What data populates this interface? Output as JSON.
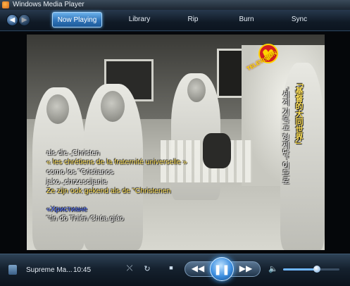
{
  "window": {
    "title": "Windows Media Player"
  },
  "nav": {
    "back_icon": "back-arrow-icon",
    "forward_icon": "forward-arrow-icon",
    "tabs": [
      {
        "label": "Now Playing",
        "active": true
      },
      {
        "label": "Library",
        "active": false
      },
      {
        "label": "Rip",
        "active": false
      },
      {
        "label": "Burn",
        "active": false
      },
      {
        "label": "Sync",
        "active": false
      }
    ]
  },
  "video": {
    "channel_logo_text": "TELEVISION",
    "subtitles": [
      "als die „Christen",
      "« les chrétiens de la fraternité universelle »",
      "como los \"Cristianos",
      "jako „chrzescijanie",
      "Ze zijn ook gekend als de \"Christenen",
      "«Христиане",
      "\"tín đồ Thiên Chúa giáo"
    ],
    "vertical_chinese": "「基督的大同世界」",
    "vertical_korean": "\"세계 기독교 형제단\" 이므로"
  },
  "controls": {
    "current_media": "Supreme Ma...",
    "time": "10:45",
    "volume_level": 0.6,
    "colors": {
      "accent": "#3c8ee0",
      "subtitle_yellow": "#ffe15a",
      "subtitle_blue": "#4d6cff"
    }
  }
}
